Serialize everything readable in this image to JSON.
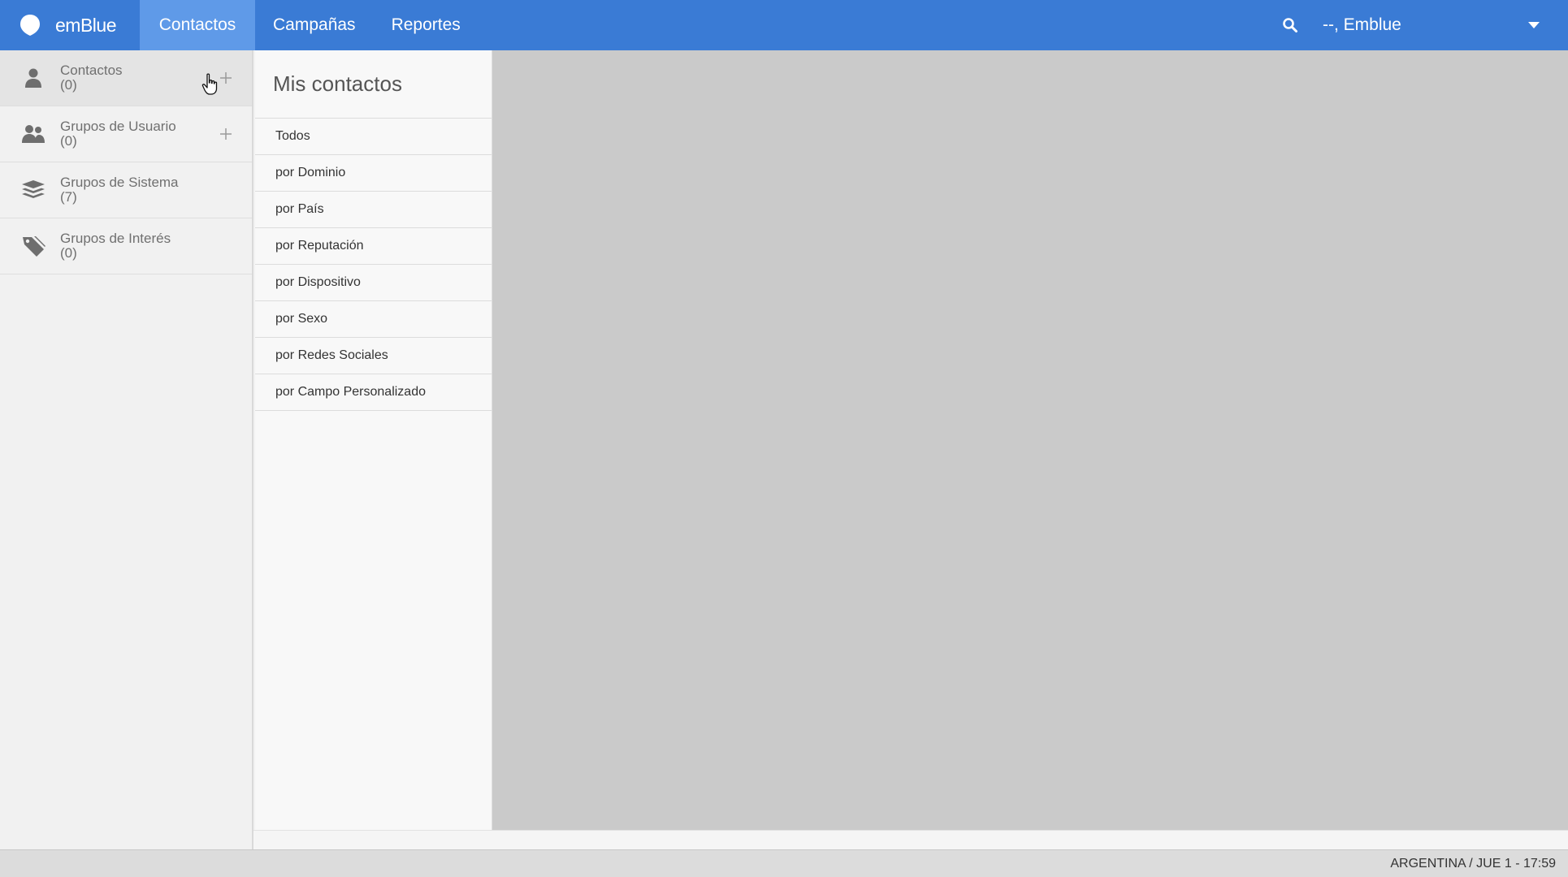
{
  "app": {
    "brand": "emBlue",
    "accent_color": "#3a7bd5",
    "active_tab_color": "#5f9ae8"
  },
  "nav": {
    "tabs": [
      {
        "label": "Contactos",
        "active": true
      },
      {
        "label": "Campañas",
        "active": false
      },
      {
        "label": "Reportes",
        "active": false
      }
    ]
  },
  "header": {
    "search_icon": "search-icon",
    "user_label": "--, Emblue",
    "dropdown_icon": "caret-down-icon"
  },
  "sidebar": {
    "items": [
      {
        "label": "Contactos",
        "count": "(0)",
        "icon": "person-icon",
        "has_add": true
      },
      {
        "label": "Grupos de Usuario",
        "count": "(0)",
        "icon": "group-icon",
        "has_add": true
      },
      {
        "label": "Grupos de Sistema",
        "count": "(7)",
        "icon": "layers-icon",
        "has_add": false
      },
      {
        "label": "Grupos de Interés",
        "count": "(0)",
        "icon": "tag-icon",
        "has_add": false
      }
    ]
  },
  "submenu": {
    "title": "Mis contactos",
    "items": [
      "Todos",
      "por Dominio",
      "por País",
      "por Reputación",
      "por Dispositivo",
      "por Sexo",
      "por Redes Sociales",
      "por Campo Personalizado"
    ]
  },
  "status": {
    "text": "ARGENTINA / JUE 1 - 17:59"
  }
}
